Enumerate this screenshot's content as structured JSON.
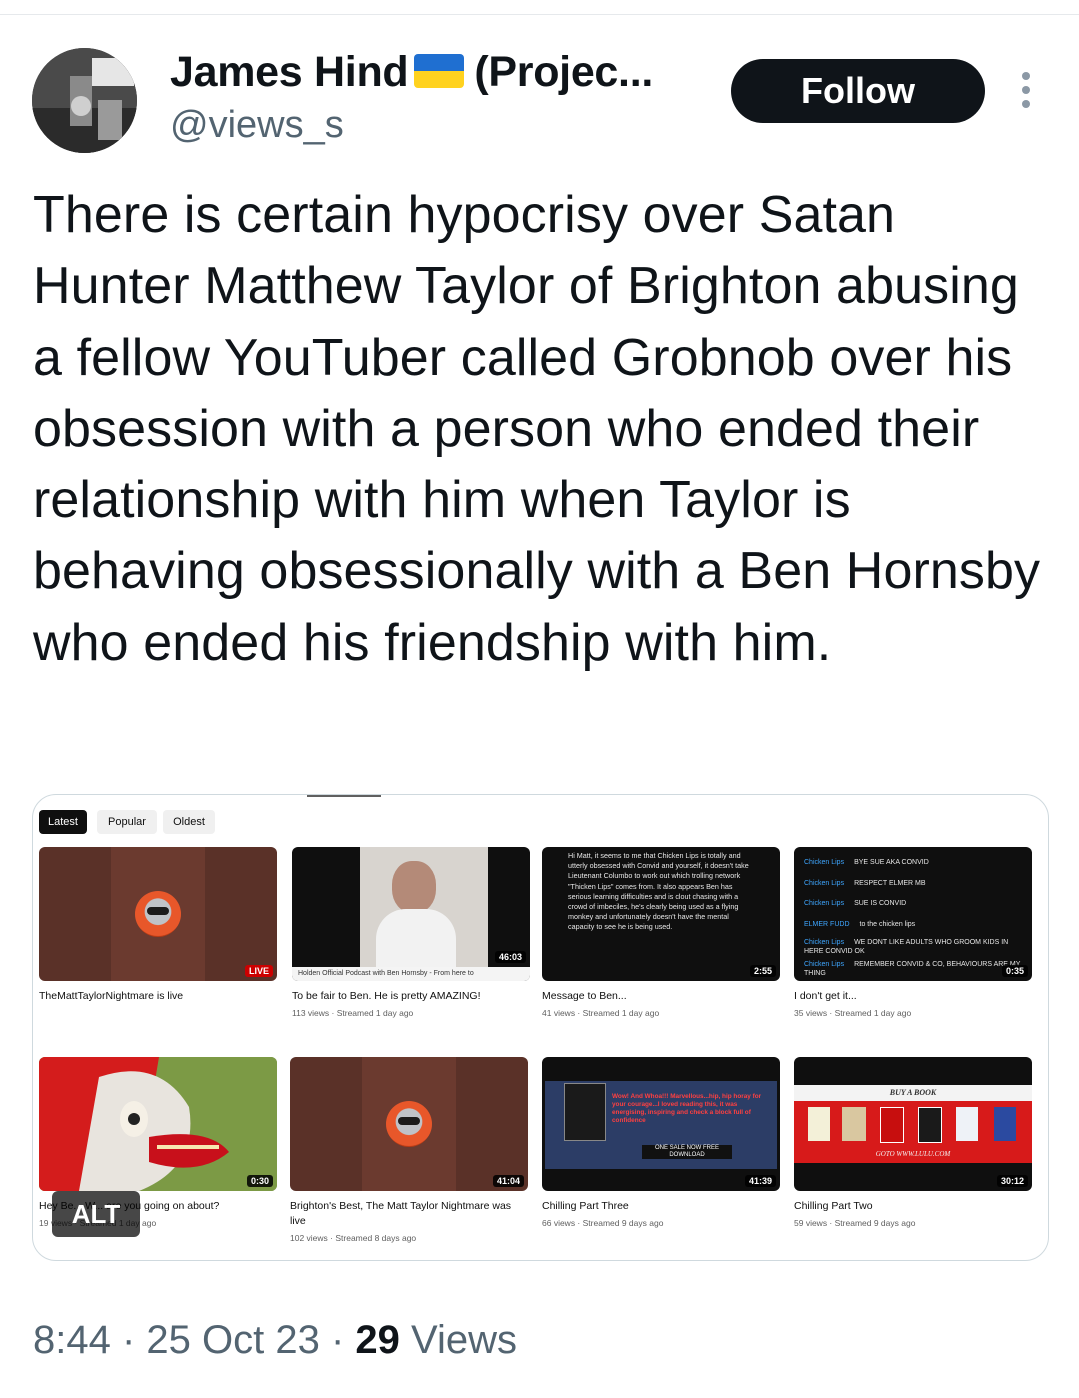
{
  "author": {
    "name": "James Hind",
    "name_suffix": "(Projec...",
    "handle": "@views_s",
    "flag_icon": "ukraine-flag-icon"
  },
  "follow_label": "Follow",
  "tweet_text": "There is certain hypocrisy over Satan Hunter Matthew Taylor of Brighton abusing a fellow YouTuber called Grobnob over his obsession with a person who ended their relationship with him when Taylor is behaving obsessionally with a Ben Hornsby who ended his friendship with him.",
  "media": {
    "filters": [
      "Latest",
      "Popular",
      "Oldest"
    ],
    "videos": [
      {
        "title": "TheMattTaylorNightmare is live",
        "badge": "LIVE",
        "meta": ""
      },
      {
        "title": "To be fair to Ben. He is pretty AMAZING!",
        "badge": "46:03",
        "meta": "113 views · Streamed 1 day ago",
        "caption": "Holden Official Podcast with Ben Hornsby - From here to"
      },
      {
        "title": "Message to Ben...",
        "badge": "2:55",
        "meta": "41 views · Streamed 1 day ago",
        "text": "Hi Matt, it seems to me that Chicken Lips is totally and utterly obsessed with Convid and yourself, it doesn't take Lieutenant Columbo to work out which trolling network \"Thicken Lips\" comes from. It also appears Ben has serious learning difficulties and is clout chasing with a crowd of imbeciles, he's clearly being used as a flying monkey and unfortunately doesn't have the mental capacity to see he is being used."
      },
      {
        "title": "I don't get it...",
        "badge": "0:35",
        "meta": "35 views · Streamed 1 day ago",
        "chat": [
          {
            "user": "Chicken Lips",
            "msg": "BYE SUE AKA CONVID"
          },
          {
            "user": "Chicken Lips",
            "msg": "RESPECT ELMER MB"
          },
          {
            "user": "Chicken Lips",
            "msg": "SUE IS CONVID"
          },
          {
            "user": "ELMER FUDD",
            "msg": "to the chicken lips"
          },
          {
            "user": "Chicken Lips",
            "msg": "WE DONT LIKE ADULTS WHO GROOM KIDS IN HERE CONVID OK"
          },
          {
            "user": "Chicken Lips",
            "msg": "REMEMBER CONVID & CO, BEHAVIOURS ARE MY THING"
          }
        ]
      },
      {
        "title": "Hey Be... W... are you going on about?",
        "badge": "0:30",
        "meta": "19 views · Streamed 1 day ago"
      },
      {
        "title": "Brighton's Best, The Matt Taylor Nightmare was live",
        "badge": "41:04",
        "meta": "102 views · Streamed 8 days ago"
      },
      {
        "title": "Chilling Part Three",
        "badge": "41:39",
        "meta": "66 views · Streamed 9 days ago",
        "promo_text": "Wow! And Whoa!!! Marvellous...hip, hip horay for your courage...I loved reading this, it was energising, inspiring and check a block full of confidence",
        "promo_button": "ONE SALE NOW FREE DOWNLOAD"
      },
      {
        "title": "Chilling Part Two",
        "badge": "30:12",
        "meta": "59 views · Streamed 9 days ago",
        "promo_top": "BUY A BOOK",
        "promo_bottom": "GOTO WWW.LULU.COM"
      }
    ]
  },
  "alt_label": "ALT",
  "footer": {
    "time": "8:44",
    "date": "25 Oct 23",
    "views_count": "29",
    "views_label": "Views"
  }
}
